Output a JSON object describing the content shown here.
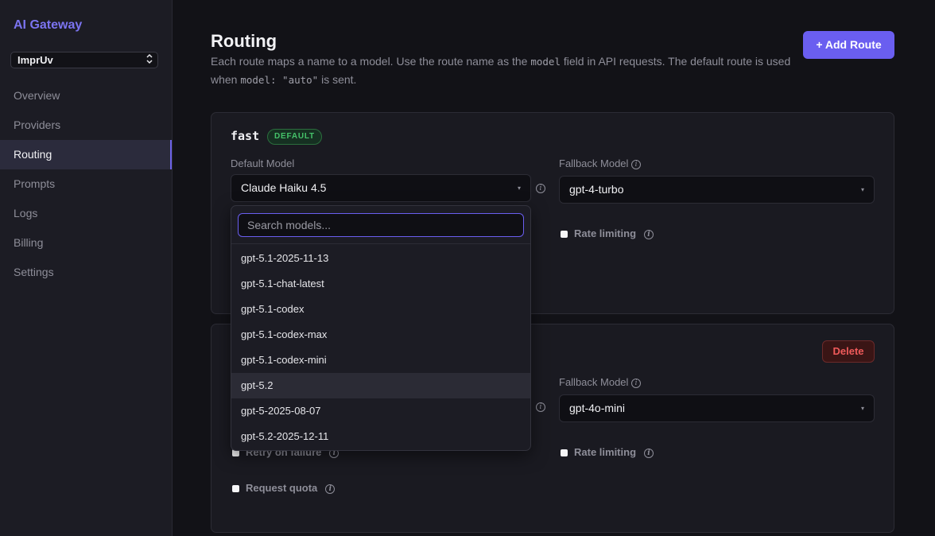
{
  "sidebar": {
    "brand": "AI Gateway",
    "workspace": "ImprUv",
    "items": [
      {
        "label": "Overview"
      },
      {
        "label": "Providers"
      },
      {
        "label": "Routing"
      },
      {
        "label": "Prompts"
      },
      {
        "label": "Logs"
      },
      {
        "label": "Billing"
      },
      {
        "label": "Settings"
      }
    ],
    "active": "Routing"
  },
  "header": {
    "title": "Routing",
    "desc_part1": "Each route maps a name to a model. Use the route name as the ",
    "desc_code1": "model",
    "desc_part2": " field in API requests. The default route is used when ",
    "desc_code2": "model: \"auto\"",
    "desc_part3": " is sent.",
    "add_route_label": "+ Add Route"
  },
  "routes": [
    {
      "name": "fast",
      "badge": "DEFAULT",
      "default_model_label": "Default Model",
      "default_model_value": "Claude Haiku 4.5",
      "fallback_model_label": "Fallback Model",
      "fallback_model_value": "gpt-4-turbo",
      "rate_limiting_label": "Rate limiting"
    },
    {
      "delete_label": "Delete",
      "fallback_model_label": "Fallback Model",
      "fallback_model_value": "gpt-4o-mini",
      "retry_label": "Retry on failure",
      "rate_limiting_label": "Rate limiting",
      "request_quota_label": "Request quota"
    }
  ],
  "dropdown": {
    "search_placeholder": "Search models...",
    "options": [
      "gpt-5.1-2025-11-13",
      "gpt-5.1-chat-latest",
      "gpt-5.1-codex",
      "gpt-5.1-codex-max",
      "gpt-5.1-codex-mini",
      "gpt-5.2",
      "gpt-5-2025-08-07",
      "gpt-5.2-2025-12-11"
    ],
    "highlighted": "gpt-5.2"
  },
  "icons": {
    "info": "ⓘ",
    "select_arrow": "▾",
    "workspace_chevron": "⇅"
  },
  "colors": {
    "accent": "#6a5ef0",
    "default_badge": "#45c26a",
    "delete": "#ef5a5a"
  }
}
